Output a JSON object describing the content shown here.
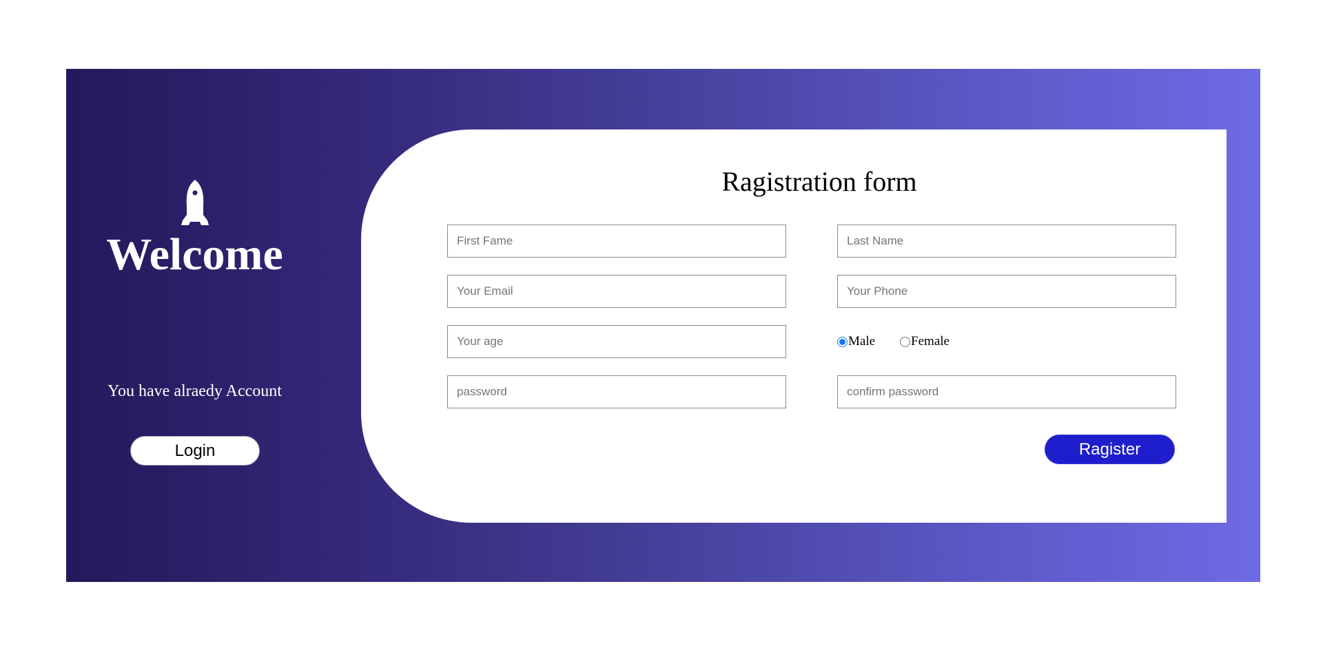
{
  "left_panel": {
    "icon": "rocket-icon",
    "welcome": "Welcome",
    "already_account": "You have alraedy Account",
    "login_label": "Login"
  },
  "form": {
    "title": "Ragistration form",
    "first_name": {
      "value": "",
      "placeholder": "First Fame"
    },
    "last_name": {
      "value": "",
      "placeholder": "Last Name"
    },
    "email": {
      "value": "",
      "placeholder": "Your Email"
    },
    "phone": {
      "value": "",
      "placeholder": "Your Phone"
    },
    "age": {
      "value": "",
      "placeholder": "Your age"
    },
    "password": {
      "value": "",
      "placeholder": "password"
    },
    "confirm_password": {
      "value": "",
      "placeholder": "confirm password"
    },
    "gender": {
      "options": [
        "Male",
        "Female"
      ],
      "selected": "Male"
    },
    "register_label": "Ragister"
  },
  "colors": {
    "gradient_start": "#23195a",
    "gradient_end": "#6e6ae4",
    "register_button": "#1e1ecc"
  }
}
